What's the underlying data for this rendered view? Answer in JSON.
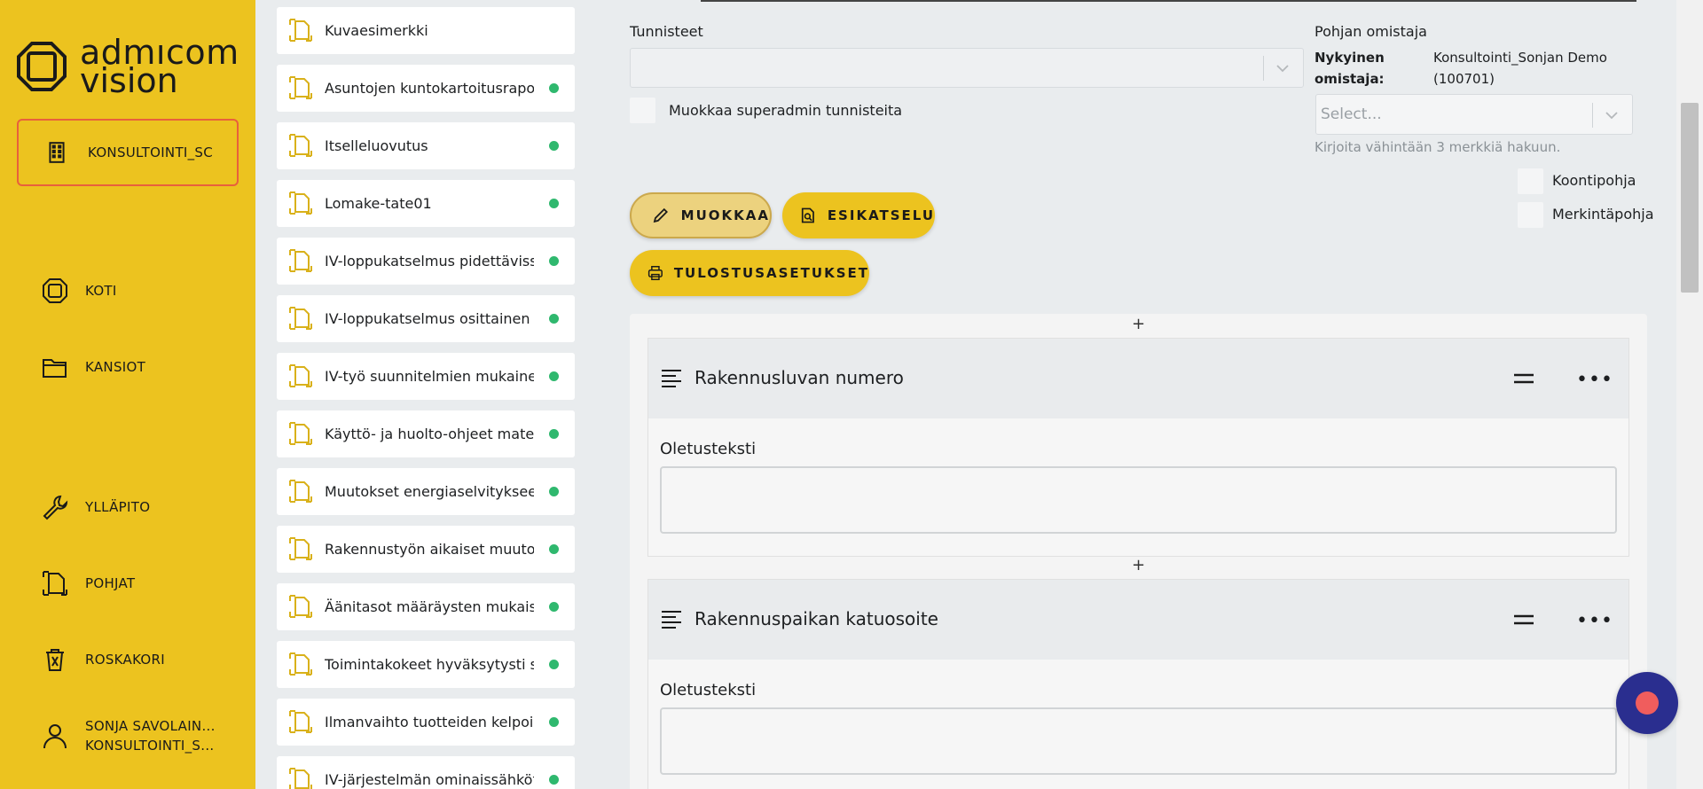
{
  "brand": {
    "line1": "admıcom",
    "line2": "vision"
  },
  "sidebar": {
    "org": "KONSULTOINTI_SC",
    "items": [
      {
        "label": "KOTI",
        "icon": "home-icon"
      },
      {
        "label": "KANSIOT",
        "icon": "folder-icon"
      },
      {
        "label": "YLLÄPITO",
        "icon": "wrench-icon"
      },
      {
        "label": "POHJAT",
        "icon": "template-icon"
      },
      {
        "label": "ROSKAKORI",
        "icon": "trash-icon"
      }
    ],
    "user": {
      "name": "SONJA SAVOLAIN...",
      "org": "KONSULTOINTI_S..."
    }
  },
  "templates": [
    {
      "name": "Kuvaesimerkki",
      "active": false
    },
    {
      "name": "Asuntojen kuntokartoitusraportti",
      "active": true
    },
    {
      "name": "Itselleluovutus",
      "active": true
    },
    {
      "name": "Lomake-tate01",
      "active": true
    },
    {
      "name": "IV-loppukatselmus pidettävissä",
      "active": true
    },
    {
      "name": "IV-loppukatselmus osittainen (ka",
      "active": true
    },
    {
      "name": "IV-työ suunnitelmien mukainen j",
      "active": true
    },
    {
      "name": "Käyttö- ja huolto-ohjeet materia",
      "active": true
    },
    {
      "name": "Muutokset energiaselvitykseen",
      "active": true
    },
    {
      "name": "Rakennustyön aikaiset muutoks",
      "active": true
    },
    {
      "name": "Äänitasot määräysten mukaiset",
      "active": true
    },
    {
      "name": "Toimintakokeet hyväksytysti suo",
      "active": true
    },
    {
      "name": "Ilmanvaihto tuotteiden kelpoisuu",
      "active": true
    },
    {
      "name": "IV-järjestelmän ominaissähköteh",
      "active": true
    }
  ],
  "form": {
    "tags_label": "Tunnisteet",
    "superadmin_label": "Muokkaa superadmin tunnisteita",
    "owner_label": "Pohjan omistaja",
    "current_owner_label_1": "Nykyinen",
    "current_owner_label_2": "omistaja:",
    "current_owner_value_1": "Konsultointi_Sonjan Demo",
    "current_owner_value_2": "(100701)",
    "owner_placeholder": "Select...",
    "owner_hint": "Kirjoita vähintään 3 merkkiä hakuun.",
    "koonti_label": "Koontipohja",
    "merkinta_label": "Merkintäpohja"
  },
  "buttons": {
    "edit": "MUOKKAA",
    "preview": "ESIKATSELU",
    "print": "TULOSTUSASETUKSET"
  },
  "fields": [
    {
      "title": "Rakennusluvan numero",
      "body_label": "Oletusteksti"
    },
    {
      "title": "Rakennuspaikan katuosoite",
      "body_label": "Oletusteksti"
    }
  ],
  "editor": {
    "add": "+"
  },
  "colors": {
    "sidebar": "#ecc31f",
    "accent_dot": "#2fb86e",
    "fab": "#2a2e8f"
  }
}
